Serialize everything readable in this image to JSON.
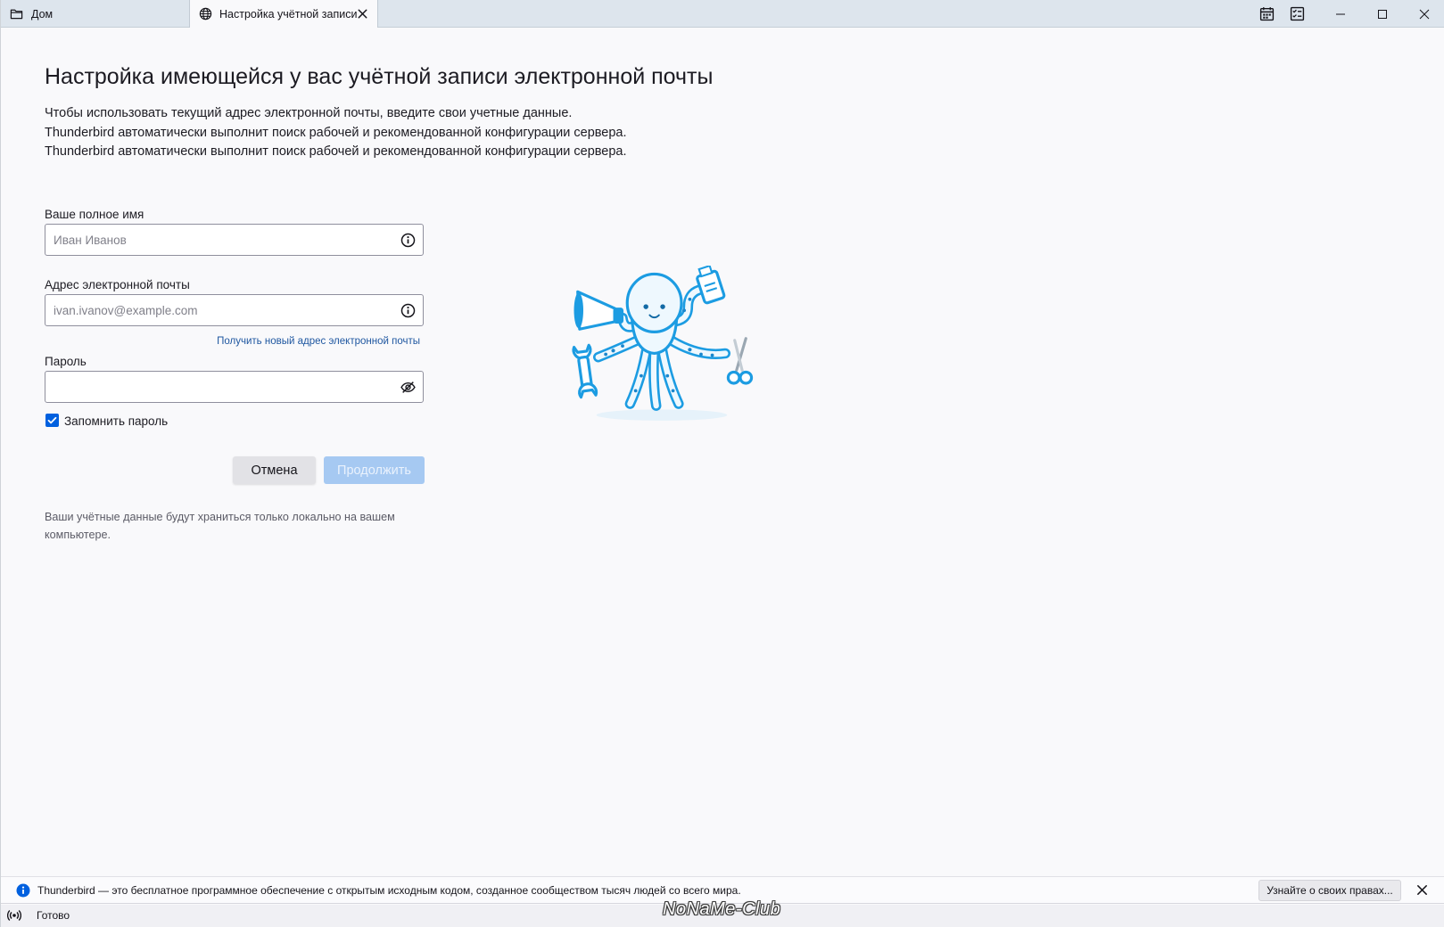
{
  "window": {
    "tabs": [
      {
        "label": "Дом",
        "icon": "folder-icon",
        "active": false
      },
      {
        "label": "Настройка учётной записи",
        "icon": "globe-icon",
        "active": true
      }
    ],
    "toolbar_icons": [
      "calendar-icon",
      "tasks-icon"
    ],
    "controls": [
      "minimize-icon",
      "maximize-icon",
      "close-icon"
    ]
  },
  "page": {
    "title": "Настройка имеющейся у вас учётной записи электронной почты",
    "intro": [
      "Чтобы использовать текущий адрес электронной почты, введите свои учетные данные.",
      "Thunderbird автоматически выполнит поиск рабочей и рекомендованной конфигурации сервера.",
      "Thunderbird автоматически выполнит поиск рабочей и рекомендованной конфигурации сервера."
    ]
  },
  "form": {
    "name": {
      "label": "Ваше полное имя",
      "placeholder": "Иван Иванов",
      "value": "",
      "icon": "info-icon"
    },
    "email": {
      "label": "Адрес электронной почты",
      "placeholder": "ivan.ivanov@example.com",
      "value": "",
      "icon": "info-icon"
    },
    "new_address_link": "Получить новый адрес электронной почты",
    "password": {
      "label": "Пароль",
      "placeholder": "",
      "value": "",
      "icon": "eye-slash-icon"
    },
    "remember": {
      "label": "Запомнить пароль",
      "checked": true
    },
    "cancel_label": "Отмена",
    "continue_label": "Продолжить",
    "continue_enabled": false
  },
  "footnote": "Ваши учётные данные будут храниться только локально на вашем компьютере.",
  "illustration": "octopus-illustration",
  "notification": {
    "icon": "info-icon",
    "text": "Thunderbird — это бесплатное программное обеспечение с открытым исходным кодом, созданное сообществом тысяч людей со всего мира.",
    "button_label": "Узнайте о своих правах...",
    "close_icon": "close-icon"
  },
  "status": {
    "icon": "broadcast-icon",
    "text": "Готово"
  },
  "watermark": "NoNaMe-Club",
  "colors": {
    "accent": "#0060df",
    "link": "#1f57a0",
    "titlebar": "#dde5ed",
    "background": "#f9f9fb",
    "disabled_button": "#a6c9f2",
    "illustration_blue": "#1c9ce2"
  }
}
